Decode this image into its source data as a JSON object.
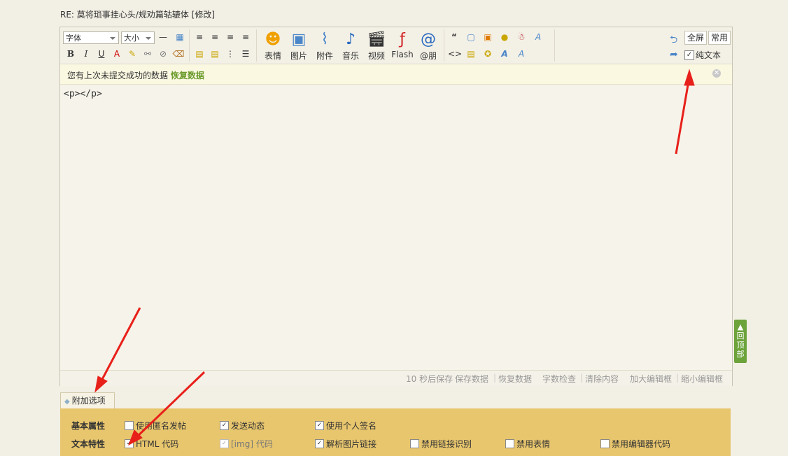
{
  "header": {
    "crumbs": "·  ·  ·  ·  ·  ·",
    "post_title": "RE: 莫将琐事挂心头/规劝篇轱辘体",
    "edit_label": "[修改]"
  },
  "toolbar": {
    "font_select": "字体",
    "size_select": "大小",
    "big_buttons": [
      {
        "label": "表情",
        "icon": "smiley-icon"
      },
      {
        "label": "图片",
        "icon": "image-icon"
      },
      {
        "label": "附件",
        "icon": "paperclip-icon"
      },
      {
        "label": "音乐",
        "icon": "music-icon"
      },
      {
        "label": "视频",
        "icon": "video-icon"
      },
      {
        "label": "Flash",
        "icon": "flash-icon"
      },
      {
        "label": "@朋",
        "icon": "at-icon"
      }
    ],
    "fullscreen_label": "全屏",
    "common_label": "常用",
    "plaintext_label": "纯文本",
    "plaintext_checked": true
  },
  "notice": {
    "text": "您有上次未提交成功的数据",
    "restore_label": "恢复数据"
  },
  "content": "<p></p>",
  "status_bar": {
    "autosave": "10 秒后保存",
    "save_data": "保存数据",
    "restore_data": "恢复数据",
    "word_check": "字数检查",
    "clear_content": "清除内容",
    "enlarge": "加大编辑框",
    "shrink": "缩小编辑框"
  },
  "attach": {
    "tab_label": "附加选项",
    "rows": [
      {
        "heading": "基本属性",
        "options": [
          {
            "label": "使用匿名发帖",
            "checked": false
          },
          {
            "label": "发送动态",
            "checked": true
          },
          {
            "label": "使用个人签名",
            "checked": true
          }
        ]
      },
      {
        "heading": "文本特性",
        "options": [
          {
            "label": "HTML 代码",
            "checked": true
          },
          {
            "label": "[img] 代码",
            "checked": true
          },
          {
            "label": "解析图片链接",
            "checked": true
          },
          {
            "label": "禁用链接识别",
            "checked": false
          },
          {
            "label": "禁用表情",
            "checked": false
          },
          {
            "label": "禁用编辑器代码",
            "checked": false
          }
        ]
      }
    ]
  },
  "back_to_top": "回顶部",
  "colors": {
    "accent_green": "#6b9b2c",
    "options_bg": "#e8c66e",
    "arrow": "#e8201a"
  }
}
